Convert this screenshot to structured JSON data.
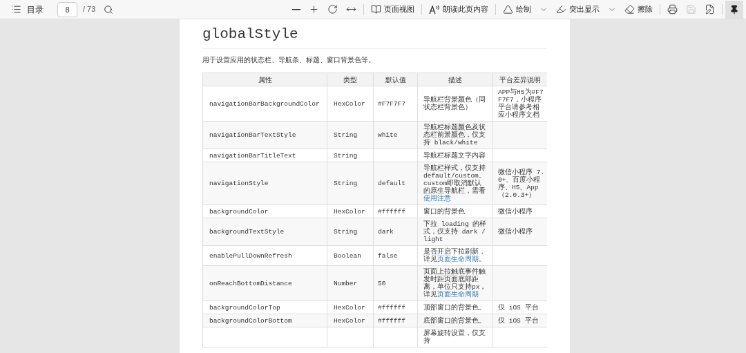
{
  "toolbar": {
    "toc": {
      "label": "目录"
    },
    "page_input": {
      "value": "8"
    },
    "page_total": "/ 73",
    "tools": [
      {
        "kind": "minus",
        "disabled": false
      },
      {
        "kind": "plus",
        "disabled": false
      },
      {
        "kind": "rotate",
        "disabled": false
      },
      {
        "kind": "fit",
        "disabled": false,
        "divider_after": true
      },
      {
        "kind": "pageview",
        "label": "页面视图",
        "disabled": false,
        "divider_after": true
      },
      {
        "kind": "read",
        "label": "朗读此页内容",
        "disabled": false,
        "divider_after": true
      },
      {
        "kind": "draw",
        "label": "绘制",
        "disabled": false,
        "dropdown": true
      },
      {
        "kind": "highlight",
        "label": "突出显示",
        "disabled": false,
        "dropdown": true
      },
      {
        "kind": "erase",
        "label": "擦除",
        "disabled": false,
        "divider_after": true
      },
      {
        "kind": "print",
        "disabled": false
      },
      {
        "kind": "save",
        "disabled": true
      },
      {
        "kind": "saveas",
        "disabled": false,
        "divider_after": true
      }
    ],
    "pin": {
      "on": true
    }
  },
  "document": {
    "title": "globalStyle",
    "intro": "用于设置应用的状态栏、导航条、标题、窗口背景色等。",
    "table": {
      "columns": [
        "属性",
        "类型",
        "默认值",
        "描述",
        "平台差异说明"
      ],
      "rows": [
        {
          "property": "navigationBarBackgroundColor",
          "type": "HexColor",
          "default": "#F7F7F7",
          "description": [
            {
              "text": "导航栏背景颜色（同状态栏背景色）",
              "link": false
            }
          ],
          "platform": "APP与H5为#F7F7F7，小程序平台请参考相应小程序文档"
        },
        {
          "property": "navigationBarTextStyle",
          "type": "String",
          "default": "white",
          "description": [
            {
              "text": "导航栏标题颜色及状态栏前景颜色，仅支持 black/white",
              "link": false
            }
          ]
        },
        {
          "property": "navigationBarTitleText",
          "type": "String",
          "description": [
            {
              "text": "导航栏标题文字内容",
              "link": false
            }
          ]
        },
        {
          "property": "navigationStyle",
          "type": "String",
          "default": "default",
          "description": [
            {
              "text": "导航栏样式，仅支持default/custom。custom即取消默认的原生导航栏，需看",
              "link": false
            },
            {
              "text": "使用注意",
              "link": true
            }
          ],
          "platform": "微信小程序 7.0+、百度小程序、H5、App（2.0.3+）"
        },
        {
          "property": "backgroundColor",
          "type": "HexColor",
          "default": "#ffffff",
          "description": [
            {
              "text": "窗口的背景色",
              "link": false
            }
          ],
          "platform": "微信小程序"
        },
        {
          "property": "backgroundTextStyle",
          "type": "String",
          "default": "dark",
          "description": [
            {
              "text": "下拉 loading 的样式，仅支持 dark / light",
              "link": false
            }
          ],
          "platform": "微信小程序"
        },
        {
          "property": "enablePullDownRefresh",
          "type": "Boolean",
          "default": "false",
          "description": [
            {
              "text": "是否开启下拉刷新，详见",
              "link": false
            },
            {
              "text": "页面生命周期",
              "link": true
            },
            {
              "text": "。",
              "link": false
            }
          ]
        },
        {
          "property": "onReachBottomDistance",
          "type": "Number",
          "default": "50",
          "description": [
            {
              "text": "页面上拉触底事件触发时距页面底部距离，单位只支持px，详见",
              "link": false
            },
            {
              "text": "页面生命周期",
              "link": true
            }
          ]
        },
        {
          "property": "backgroundColorTop",
          "type": "HexColor",
          "default": "#ffffff",
          "description": [
            {
              "text": "顶部窗口的背景色。",
              "link": false
            }
          ],
          "platform": "仅 iOS 平台"
        },
        {
          "property": "backgroundColorBottom",
          "type": "HexColor",
          "default": "#ffffff",
          "description": [
            {
              "text": "底部窗口的背景色。",
              "link": false
            }
          ],
          "platform": "仅 iOS 平台"
        },
        {
          "description": [
            {
              "text": "屏幕旋转设置，仅支持",
              "link": false
            }
          ]
        }
      ]
    }
  }
}
